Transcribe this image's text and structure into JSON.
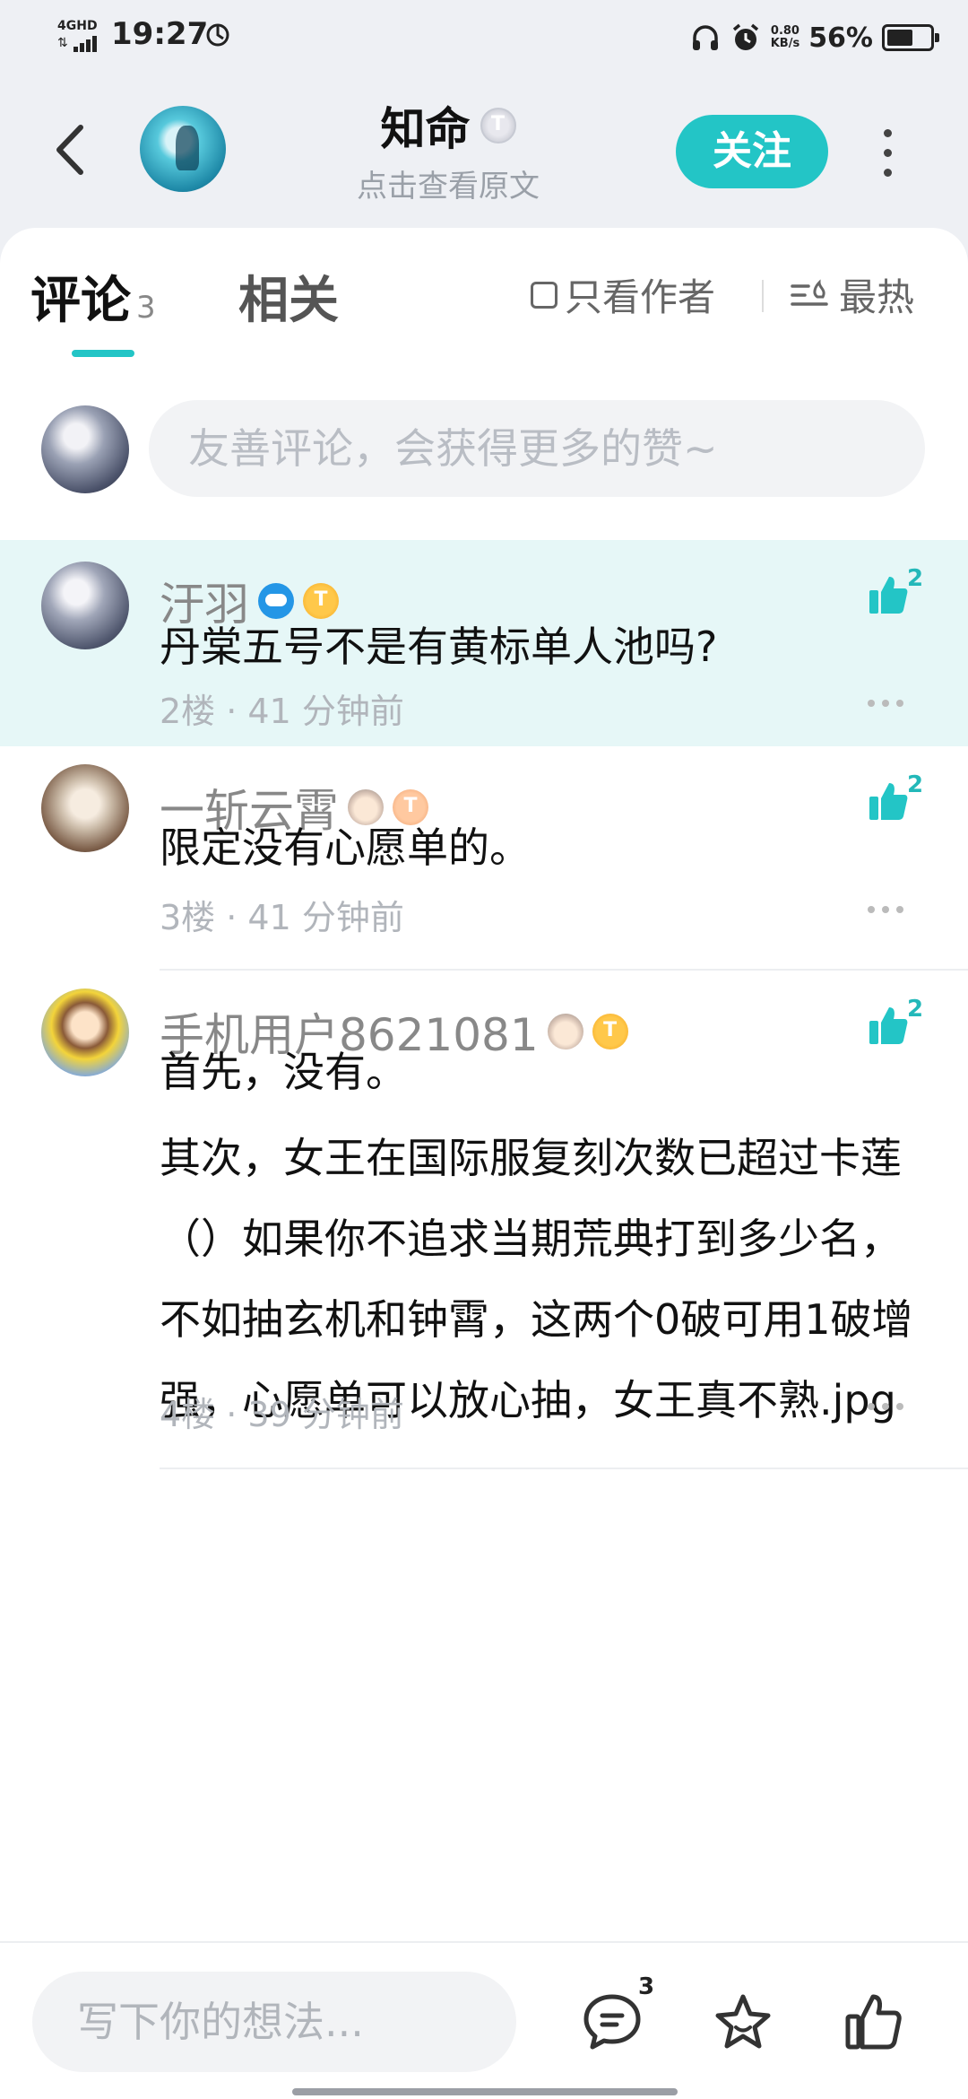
{
  "status_bar": {
    "network": "4GHD",
    "time": "19:27",
    "speed_value": "0.80",
    "speed_unit": "KB/s",
    "battery": "56%"
  },
  "header": {
    "title": "知命",
    "level_badge": "T",
    "subtitle": "点击查看原文",
    "follow_label": "关注"
  },
  "tabs": {
    "comments_label": "评论",
    "comments_count": "3",
    "related_label": "相关",
    "author_only_label": "只看作者",
    "sort_label": "最热"
  },
  "composer": {
    "placeholder": "友善评论，会获得更多的赞~"
  },
  "comments": [
    {
      "name": "汙羽",
      "badge": "T",
      "likes": "2",
      "text": "丹棠五号不是有黄标单人池吗?",
      "meta": "2楼 · 41 分钟前"
    },
    {
      "name": "一斩云霄",
      "badge": "T",
      "likes": "2",
      "text": "限定没有心愿单的。",
      "meta": "3楼 · 41 分钟前"
    },
    {
      "name": "手机用户8621081",
      "badge": "T",
      "likes": "2",
      "text_p1": "首先，没有。",
      "text_p2": "其次，女王在国际服复刻次数已超过卡莲（）如果你不追求当期荒典打到多少名，不如抽玄机和钟霄，这两个0破可用1破增强，心愿单可以放心抽，女王真不熟.jpg",
      "meta": "4楼 · 39 分钟前"
    }
  ],
  "bottom_bar": {
    "write_placeholder": "写下你的想法...",
    "comment_count": "3"
  },
  "colors": {
    "accent": "#23c5c6",
    "highlight_bg": "#e6f7f7",
    "badge_gold": "#f2a21b",
    "badge_bronze": "#ee9c68"
  },
  "icons": [
    "back-arrow-icon",
    "more-vertical-icon",
    "checkbox-icon",
    "sort-hot-icon",
    "thumbs-up-icon",
    "more-horizontal-icon",
    "comment-bubble-icon",
    "star-icon"
  ]
}
